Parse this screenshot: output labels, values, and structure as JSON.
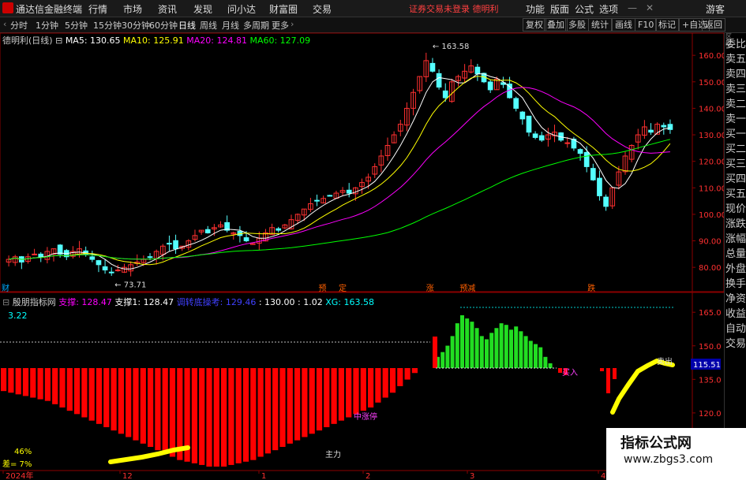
{
  "app": {
    "title": "通达信金融终端",
    "menu": [
      "行情",
      "市场",
      "资讯",
      "发现",
      "问小达",
      "财富圈",
      "交易"
    ],
    "notice": "证券交易未登录  德明利",
    "right_menu": [
      "功能",
      "版面",
      "公式",
      "选项"
    ],
    "guest": "游客"
  },
  "toolbar": {
    "periods": [
      "分时",
      "1分钟",
      "5分钟",
      "15分钟",
      "30分钟",
      "60分钟",
      "日线",
      "周线",
      "月线",
      "多周期",
      "更多"
    ],
    "active": "日线",
    "right_buttons": [
      "复权",
      "叠加",
      "多股",
      "统计",
      "画线",
      "F10",
      "标记",
      "+自选",
      "返回"
    ]
  },
  "main_panel": {
    "stock_label": "德明利(日线)",
    "ma": [
      {
        "label": "MA5: 130.65",
        "color": "#ffffff"
      },
      {
        "label": "MA10: 125.91",
        "color": "#ffff00"
      },
      {
        "label": "MA20: 124.81",
        "color": "#ff00ff"
      },
      {
        "label": "MA60: 127.09",
        "color": "#00ff00"
      }
    ],
    "y_axis": [
      "160.00",
      "150.00",
      "140.00",
      "130.00",
      "120.00",
      "110.00",
      "100.00",
      "90.00",
      "80.00"
    ],
    "y_range": [
      75,
      166
    ],
    "high_label": "163.58",
    "low_label": "73.71",
    "markers": [
      "预",
      "定",
      "涨",
      "预减",
      "跌"
    ],
    "left_tag": "财"
  },
  "indicator_panel": {
    "name": "殷朋指标网",
    "items": [
      {
        "label": "支撑: 128.47",
        "color": "#ff00ff"
      },
      {
        "label": "支撑1: 128.47",
        "color": "#ffffff"
      },
      {
        "label": "调转底操考: 129.46",
        "color": "#4040ff"
      },
      {
        "label": ": 130.00",
        "color": "#ffffff"
      },
      {
        "label": ": 1.02",
        "color": "#ffffff"
      },
      {
        "label": "XG: 163.58",
        "color": "#00ffff"
      }
    ],
    "value_label": "3.22",
    "y_axis": [
      "165.0",
      "150.0",
      "135.0",
      "120.0",
      "105.0"
    ],
    "y_range": [
      96,
      170
    ],
    "current_value": "115.51",
    "annotations": [
      "主力",
      "中涨停",
      "买入",
      "卖出"
    ],
    "bottom_labels": [
      "46%",
      "差= 7%"
    ]
  },
  "x_axis": [
    "2024年",
    "12",
    "1",
    "2",
    "3",
    "4"
  ],
  "sidebar": [
    "委比",
    "卖五",
    "卖四",
    "卖三",
    "卖二",
    "卖一",
    "买一",
    "买二",
    "买三",
    "买四",
    "买五",
    "现价",
    "涨跌",
    "涨幅",
    "总量",
    "外盘",
    "换手",
    "净资",
    "收益",
    "自动",
    "交易"
  ],
  "watermark": {
    "title": "指标公式网",
    "url": "www.zbgs3.com"
  },
  "colors": {
    "up": "#ff3030",
    "down": "#54ffff",
    "ma5": "#ffffff",
    "ma10": "#ffff00",
    "ma20": "#ff00ff",
    "ma60": "#00ff00",
    "bar_red": "#ff0000",
    "bar_green": "#22dd22",
    "yellow": "#ffff00"
  },
  "chart_data": [
    {
      "type": "candlestick",
      "title": "德明利(日线)",
      "closes": [
        83,
        84,
        82,
        84,
        85,
        84,
        86,
        87,
        85,
        84,
        86,
        87,
        85,
        83,
        81,
        79,
        78,
        79,
        80,
        81,
        82,
        83,
        84,
        86,
        88,
        89,
        87,
        88,
        90,
        92,
        94,
        93,
        95,
        96,
        94,
        93,
        92,
        90,
        89,
        91,
        93,
        95,
        94,
        96,
        98,
        100,
        102,
        104,
        105,
        106,
        107,
        108,
        109,
        108,
        110,
        112,
        114,
        118,
        122,
        126,
        130,
        134,
        140,
        146,
        152,
        158,
        154,
        148,
        144,
        150,
        152,
        154,
        156,
        153,
        150,
        147,
        151,
        149,
        144,
        140,
        136,
        131,
        129,
        128,
        130,
        131,
        128,
        127,
        125,
        123,
        118,
        113,
        107,
        103,
        110,
        116,
        122,
        126,
        130,
        133,
        131,
        134,
        133,
        132
      ],
      "ma5_last": 130.65,
      "ma10_last": 125.91,
      "ma20_last": 124.81,
      "ma60_last": 127.09,
      "high": 163.58,
      "low": 73.71,
      "ylim": [
        75,
        166
      ]
    },
    {
      "type": "bar",
      "title": "殷朋指标网",
      "red_depth": [
        14,
        15,
        16,
        17,
        18,
        19,
        20,
        22,
        24,
        26,
        28,
        30,
        32,
        34,
        36,
        38,
        40,
        42,
        44,
        46,
        48,
        50,
        52,
        54,
        56,
        57,
        58,
        59,
        60,
        60,
        60,
        59,
        58,
        57,
        56,
        54,
        52,
        50,
        48,
        46,
        44,
        42,
        40,
        38,
        36,
        34,
        32,
        30,
        28,
        26,
        24,
        21,
        18,
        15,
        11,
        7,
        3
      ],
      "green_height": [
        14,
        20,
        28,
        40,
        56,
        66,
        62,
        58,
        50,
        40,
        36,
        44,
        50,
        56,
        54,
        48,
        52,
        46,
        40,
        34,
        30,
        26,
        14,
        6
      ],
      "ylim": [
        96,
        170
      ]
    }
  ]
}
